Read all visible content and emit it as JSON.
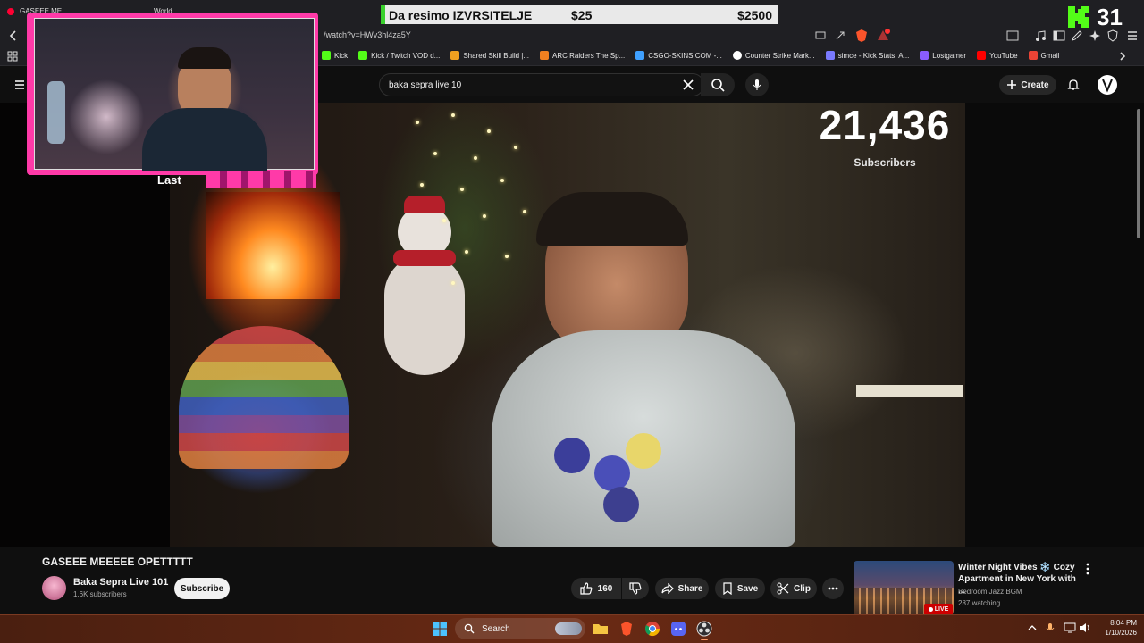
{
  "browser": {
    "tabs": [
      {
        "label": "GASEEE ME",
        "extra": "LIVE"
      },
      {
        "label": "World"
      }
    ],
    "url": "/watch?v=HWv3hl4za5Y",
    "bookmarks": [
      {
        "label": "Kick",
        "color": "#53fc18"
      },
      {
        "label": "Kick / Twitch VOD d...",
        "color": "#53fc18"
      },
      {
        "label": "Shared Skill Build |...",
        "color": "#f0a020"
      },
      {
        "label": "ARC Raiders The Sp...",
        "color": "#f08020"
      },
      {
        "label": "CSGO-SKINS.COM -...",
        "color": "#3fa0ff"
      },
      {
        "label": "Counter Strike Mark...",
        "color": "#ffffff"
      },
      {
        "label": "simce - Kick Stats, A...",
        "color": "#7a7aff"
      },
      {
        "label": "Lostgamer",
        "color": "#8a5cff"
      },
      {
        "label": "YouTube",
        "color": "#ff0000"
      },
      {
        "label": "Gmail",
        "color": "#ea4335"
      }
    ]
  },
  "youtube": {
    "search_query": "baka sepra live 10",
    "create_label": "Create"
  },
  "overlay": {
    "goal_label": "Da resimo IZVRSITELJE",
    "goal_current": "$25",
    "goal_target": "$2500",
    "kick_count": "31",
    "subscriber_count": "21,436",
    "subscriber_label": "Subscribers",
    "last_label": "Last"
  },
  "video": {
    "title": "GASEEE MEEEEE OPETTTTT",
    "channel_name": "Baka Sepra Live 101",
    "channel_subs": "1.6K subscribers",
    "subscribe_label": "Subscribe",
    "likes": "160",
    "share_label": "Share",
    "save_label": "Save",
    "clip_label": "Clip"
  },
  "recommended": {
    "title": "Winter Night Vibes ❄️ Cozy Apartment in New York with ...",
    "channel": "Bedroom Jazz BGM",
    "watching": "287 watching",
    "live_label": "LIVE"
  },
  "taskbar": {
    "search_label": "Search",
    "time": "8:04 PM",
    "date": "1/10/2026"
  },
  "colors": {
    "overlay_pink": "#ff3aa8",
    "kick_green": "#53fc18",
    "live_red": "#cc0000"
  }
}
